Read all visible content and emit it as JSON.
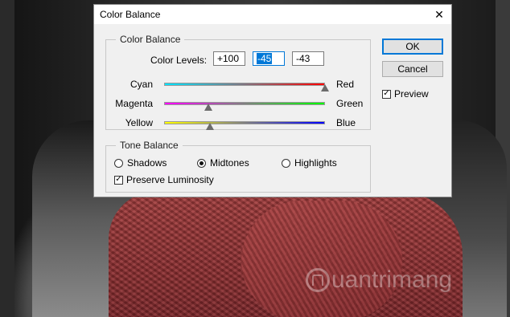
{
  "dialog": {
    "title": "Color Balance",
    "close_glyph": "✕"
  },
  "color_balance": {
    "group_label": "Color Balance",
    "levels_label": "Color Levels:",
    "levels": [
      "+100",
      "-45",
      "-43"
    ],
    "sliders": [
      {
        "left": "Cyan",
        "right": "Red",
        "value": 100
      },
      {
        "left": "Magenta",
        "right": "Green",
        "value": -45
      },
      {
        "left": "Yellow",
        "right": "Blue",
        "value": -43
      }
    ]
  },
  "tone_balance": {
    "group_label": "Tone Balance",
    "options": [
      "Shadows",
      "Midtones",
      "Highlights"
    ],
    "selected": "Midtones",
    "preserve_label": "Preserve Luminosity",
    "preserve_checked": true
  },
  "buttons": {
    "ok": "OK",
    "cancel": "Cancel"
  },
  "preview": {
    "label": "Preview",
    "checked": true
  },
  "watermark": {
    "text": "uantrimang"
  },
  "colors": {
    "accent": "#0078d7",
    "scarf": "#9a3639"
  }
}
